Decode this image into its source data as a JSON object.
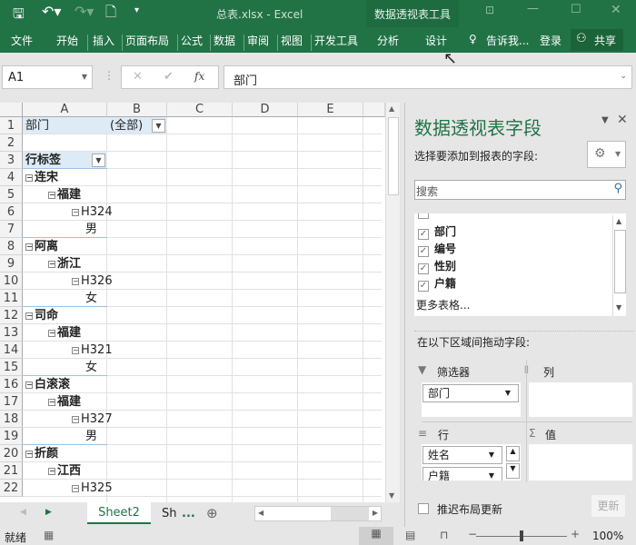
{
  "window": {
    "title": "总表.xlsx - Excel",
    "context_tab_group": "数据透视表工具"
  },
  "ribbon": {
    "tabs": [
      "文件",
      "开始",
      "插入",
      "页面布局",
      "公式",
      "数据",
      "审阅",
      "视图",
      "开发工具",
      "分析",
      "设计"
    ],
    "tell_me": "告诉我...",
    "login": "登录",
    "share": "共享"
  },
  "formula_bar": {
    "name_box": "A1",
    "value": "部门",
    "fx": "fx"
  },
  "grid": {
    "columns": [
      "A",
      "B",
      "C",
      "D",
      "E"
    ],
    "rows": [
      {
        "n": "1",
        "a": "部门",
        "b": "(全部)",
        "type": "filter"
      },
      {
        "n": "2",
        "a": ""
      },
      {
        "n": "3",
        "a": "行标签",
        "type": "header"
      },
      {
        "n": "4",
        "a": "连宋",
        "level": 0
      },
      {
        "n": "5",
        "a": "福建",
        "level": 1
      },
      {
        "n": "6",
        "a": "H324",
        "level": 2
      },
      {
        "n": "7",
        "a": "男",
        "level": 3
      },
      {
        "n": "8",
        "a": "阿离",
        "level": 0
      },
      {
        "n": "9",
        "a": "浙江",
        "level": 1
      },
      {
        "n": "10",
        "a": "H326",
        "level": 2
      },
      {
        "n": "11",
        "a": "女",
        "level": 3
      },
      {
        "n": "12",
        "a": "司命",
        "level": 0
      },
      {
        "n": "13",
        "a": "福建",
        "level": 1
      },
      {
        "n": "14",
        "a": "H321",
        "level": 2
      },
      {
        "n": "15",
        "a": "女",
        "level": 3
      },
      {
        "n": "16",
        "a": "白滚滚",
        "level": 0
      },
      {
        "n": "17",
        "a": "福建",
        "level": 1
      },
      {
        "n": "18",
        "a": "H327",
        "level": 2
      },
      {
        "n": "19",
        "a": "男",
        "level": 3
      },
      {
        "n": "20",
        "a": "折颜",
        "level": 0
      },
      {
        "n": "21",
        "a": "江西",
        "level": 1
      },
      {
        "n": "22",
        "a": "H325",
        "level": 2
      }
    ]
  },
  "sheets": {
    "active": "Sheet2",
    "other": "Sh",
    "more": "..."
  },
  "status": {
    "ready": "就绪",
    "zoom": "100%"
  },
  "panel": {
    "title": "数据透视表字段",
    "choose_label": "选择要添加到报表的字段:",
    "search_placeholder": "搜索",
    "fields": [
      {
        "name": "部门",
        "checked": true
      },
      {
        "name": "编号",
        "checked": true
      },
      {
        "name": "性别",
        "checked": true
      },
      {
        "name": "户籍",
        "checked": true
      }
    ],
    "more_tables": "更多表格...",
    "drag_label": "在以下区域间拖动字段:",
    "areas": {
      "filter": "筛选器",
      "columns": "列",
      "rows": "行",
      "values": "值"
    },
    "filter_items": [
      "部门"
    ],
    "row_items": [
      "姓名",
      "户籍"
    ],
    "defer_label": "推迟布局更新",
    "update_button": "更新"
  },
  "colors": {
    "brand": "#217346",
    "title": "#217346"
  }
}
